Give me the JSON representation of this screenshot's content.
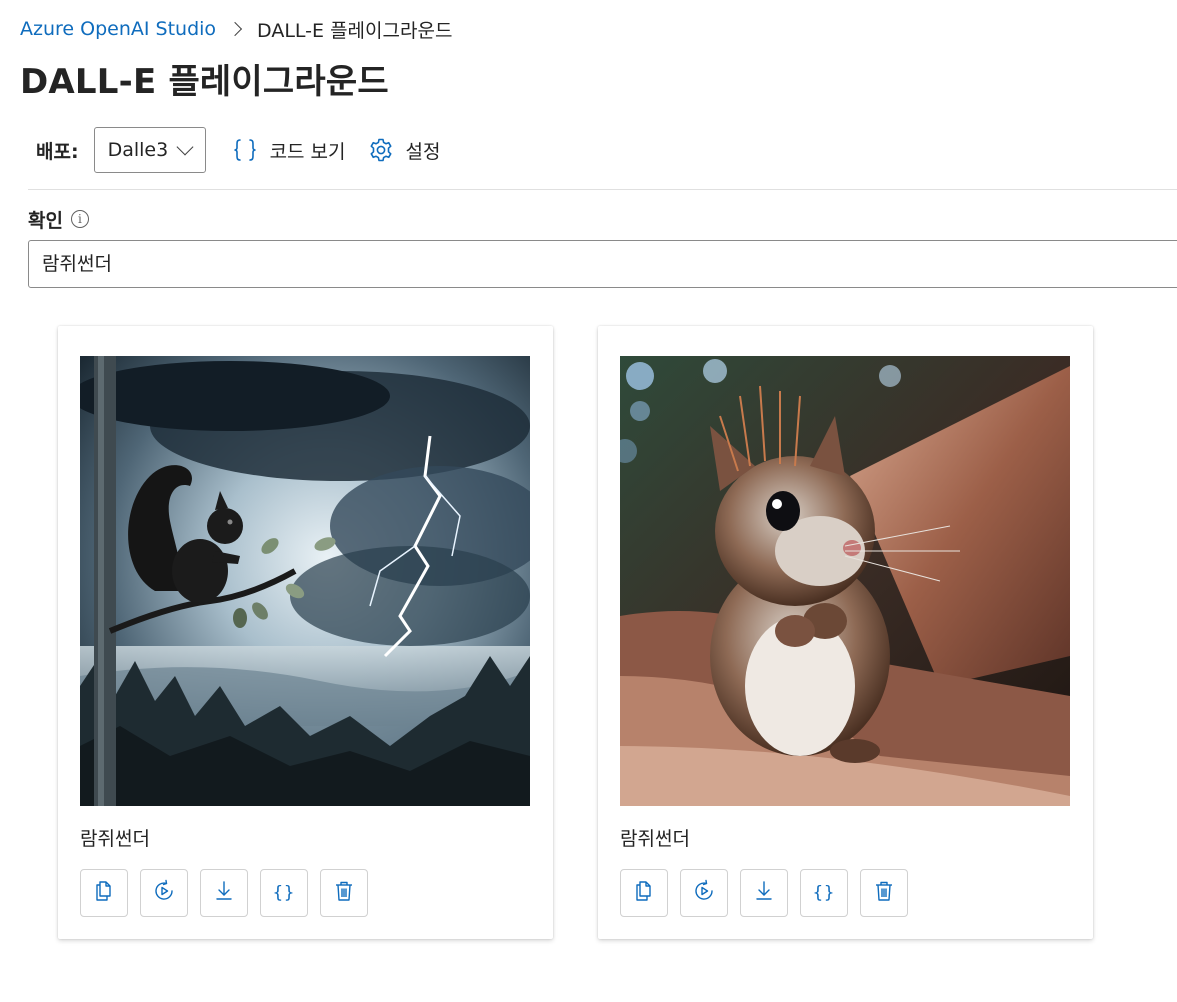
{
  "breadcrumb": {
    "root": "Azure OpenAI Studio",
    "current": "DALL-E 플레이그라운드"
  },
  "page_title": "DALL-E 플레이그라운드",
  "toolbar": {
    "deployment_label": "배포:",
    "deployment_value": "Dalle3",
    "view_code_label": "코드 보기",
    "settings_label": "설정"
  },
  "prompt": {
    "label": "확인",
    "value": "람쥐썬더"
  },
  "results": [
    {
      "image_description": "squirrel on branch with lightning storm",
      "caption": "람쥐썬더"
    },
    {
      "image_description": "close-up of a young squirrel on tree bark",
      "caption": "람쥐썬더"
    }
  ],
  "colors": {
    "accent": "#0f6cbd",
    "text": "#242424",
    "border": "#8a8a8a"
  },
  "icons": {
    "card_actions": [
      "copy-icon",
      "regenerate-icon",
      "download-icon",
      "code-icon",
      "delete-icon"
    ]
  }
}
